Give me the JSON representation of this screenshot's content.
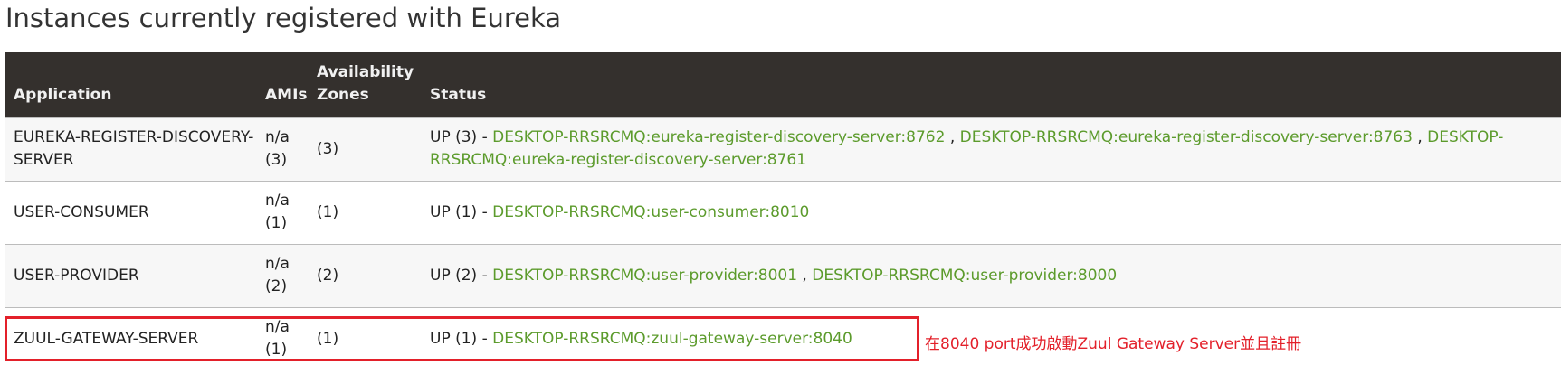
{
  "page": {
    "title": "Instances currently registered with Eureka"
  },
  "table": {
    "headers": {
      "application": "Application",
      "amis": "AMIs",
      "zones_line1": "Availability",
      "zones_line2": "Zones",
      "status": "Status"
    },
    "rows": [
      {
        "application_line1": "EUREKA-REGISTER-DISCOVERY-",
        "application_line2": "SERVER",
        "amis_line1": "n/a",
        "amis_line2": "(3)",
        "zones": "(3)",
        "status_prefix": "UP (3) - ",
        "links": [
          "DESKTOP-RRSRCMQ:eureka-register-discovery-server:8762",
          "DESKTOP-RRSRCMQ:eureka-register-discovery-server:8763",
          "DESKTOP-RRSRCMQ:eureka-register-discovery-server:8761"
        ]
      },
      {
        "application_line1": "USER-CONSUMER",
        "amis_line1": "n/a",
        "amis_line2": "(1)",
        "zones": "(1)",
        "status_prefix": "UP (1) - ",
        "links": [
          "DESKTOP-RRSRCMQ:user-consumer:8010"
        ]
      },
      {
        "application_line1": "USER-PROVIDER",
        "amis_line1": "n/a",
        "amis_line2": "(2)",
        "zones": "(2)",
        "status_prefix": "UP (2) - ",
        "links": [
          "DESKTOP-RRSRCMQ:user-provider:8001",
          "DESKTOP-RRSRCMQ:user-provider:8000"
        ]
      },
      {
        "application_line1": "ZUUL-GATEWAY-SERVER",
        "amis_line1": "n/a",
        "amis_line2": "(1)",
        "zones": "(1)",
        "status_prefix": "UP (1) - ",
        "links": [
          "DESKTOP-RRSRCMQ:zuul-gateway-server:8040"
        ]
      }
    ],
    "link_separator": " , "
  },
  "annotation": {
    "text": "在8040 port成功啟動Zuul Gateway Server並且註冊",
    "color": "#e3202a"
  },
  "colors": {
    "header_bg": "#34302d",
    "link": "#5c9b2c",
    "highlight": "#e3202a"
  }
}
